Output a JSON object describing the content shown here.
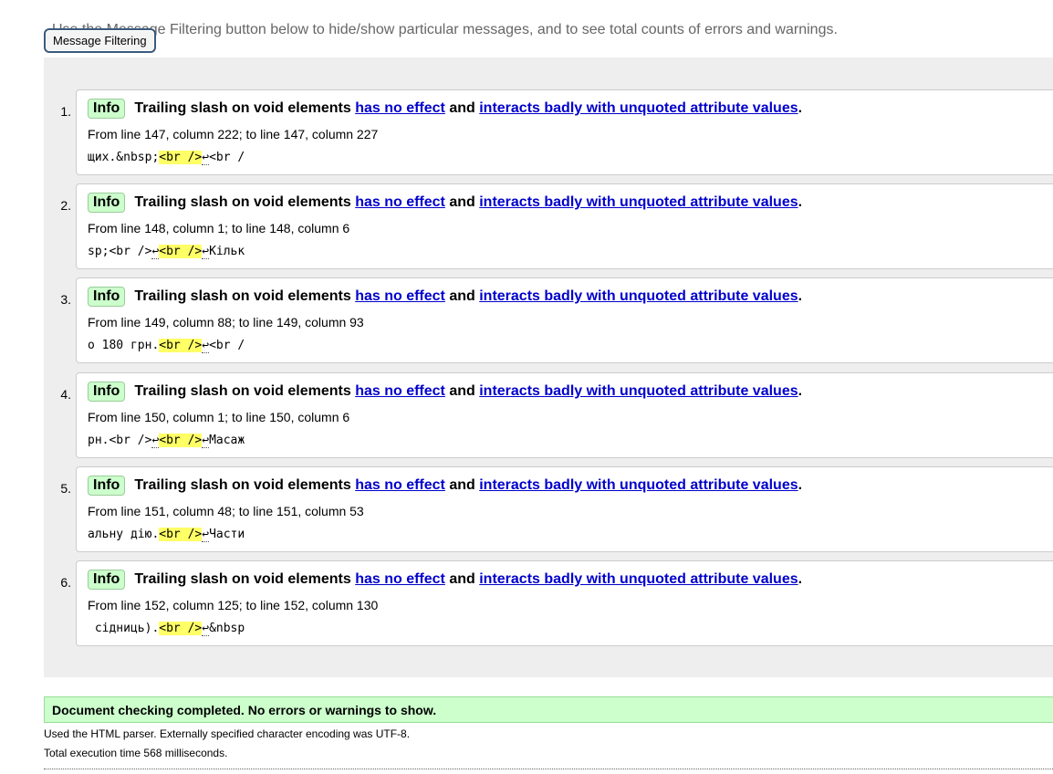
{
  "intro_text": "Use the Message Filtering button below to hide/show particular messages, and to see total counts of errors and warnings.",
  "filter_button_label": "Message Filtering",
  "messages": [
    {
      "number": "1.",
      "badge": "Info",
      "title": "Trailing slash on void elements",
      "link1": "has no effect",
      "connector": "and",
      "link2": "interacts badly with unquoted attribute values",
      "end": ".",
      "location": "From line 147, column 222; to line 147, column 227",
      "extract_pre": "щих.&nbsp;",
      "extract_hl": "<br />",
      "extract_post": "<br /",
      "lf_in_hl": false
    },
    {
      "number": "2.",
      "badge": "Info",
      "title": "Trailing slash on void elements",
      "link1": "has no effect",
      "connector": "and",
      "link2": "interacts badly with unquoted attribute values",
      "end": ".",
      "location": "From line 148, column 1; to line 148, column 6",
      "extract_pre": "sp;<br />",
      "extract_hl": "<br />",
      "extract_post": "Кільк",
      "lf_in_hl": true
    },
    {
      "number": "3.",
      "badge": "Info",
      "title": "Trailing slash on void elements",
      "link1": "has no effect",
      "connector": "and",
      "link2": "interacts badly with unquoted attribute values",
      "end": ".",
      "location": "From line 149, column 88; to line 149, column 93",
      "extract_pre": "о 180 грн.",
      "extract_hl": "<br />",
      "extract_post": "<br /",
      "lf_in_hl": false
    },
    {
      "number": "4.",
      "badge": "Info",
      "title": "Trailing slash on void elements",
      "link1": "has no effect",
      "connector": "and",
      "link2": "interacts badly with unquoted attribute values",
      "end": ".",
      "location": "From line 150, column 1; to line 150, column 6",
      "extract_pre": "рн.<br />",
      "extract_hl": "<br />",
      "extract_post": "Масаж",
      "lf_in_hl": true
    },
    {
      "number": "5.",
      "badge": "Info",
      "title": "Trailing slash on void elements",
      "link1": "has no effect",
      "connector": "and",
      "link2": "interacts badly with unquoted attribute values",
      "end": ".",
      "location": "From line 151, column 48; to line 151, column 53",
      "extract_pre": "альну дію.",
      "extract_hl": "<br />",
      "extract_post": "Части",
      "lf_in_hl": false
    },
    {
      "number": "6.",
      "badge": "Info",
      "title": "Trailing slash on void elements",
      "link1": "has no effect",
      "connector": "and",
      "link2": "interacts badly with unquoted attribute values",
      "end": ".",
      "location": "From line 152, column 125; to line 152, column 130",
      "extract_pre": " сідниць).",
      "extract_hl": "<br />",
      "extract_post": "&nbsp",
      "lf_in_hl": false
    }
  ],
  "lf_glyph": "↩",
  "success_text": "Document checking completed. No errors or warnings to show.",
  "parser_note": "Used the HTML parser. Externally specified character encoding was UTF-8.",
  "execution_time": "Total execution time 568 milliseconds.",
  "colors": {
    "info_badge_bg": "#ccffcc",
    "link": "#0000cc",
    "highlight": "#ffff66",
    "success_bg": "#ccffcc",
    "panel_bg": "#eeeeee"
  }
}
